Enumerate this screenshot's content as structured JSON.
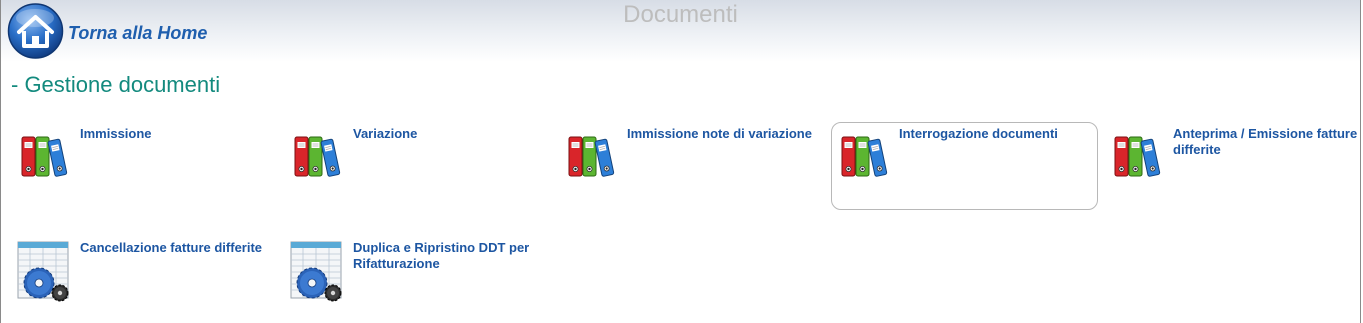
{
  "header": {
    "home_label": "Torna alla Home",
    "page_title": "Documenti"
  },
  "section": {
    "title": "- Gestione documenti"
  },
  "tiles": [
    {
      "label": "Immissione",
      "icon": "binders-icon"
    },
    {
      "label": "Variazione",
      "icon": "binders-icon"
    },
    {
      "label": "Immissione note di variazione",
      "icon": "binders-icon"
    },
    {
      "label": "Interrogazione documenti",
      "icon": "binders-icon",
      "selected": true
    },
    {
      "label": "Anteprima / Emissione fatture differite",
      "icon": "binders-icon"
    },
    {
      "label": "Cancellazione fatture differite",
      "icon": "spreadsheet-gear-icon"
    },
    {
      "label": "Duplica e Ripristino DDT per Rifatturazione",
      "icon": "spreadsheet-gear-icon"
    }
  ],
  "colors": {
    "title_teal": "#138a7e",
    "link_blue": "#1d56a2",
    "home_blue": "#1f5fae",
    "header_title_gray": "#bdbdbd"
  }
}
